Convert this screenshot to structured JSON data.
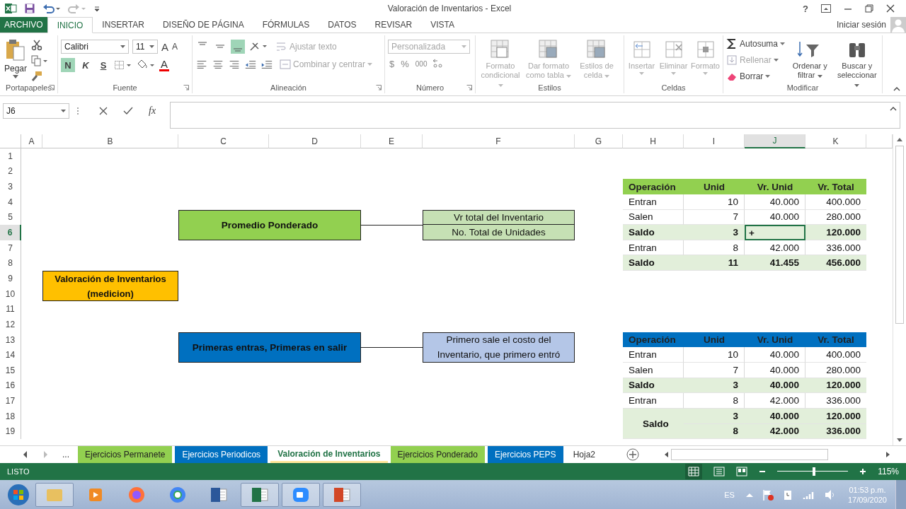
{
  "window": {
    "title": "Valoración de Inventarios - Excel",
    "help": "?"
  },
  "ribbon": {
    "tabs": [
      {
        "label": "ARCHIVO",
        "kind": "file",
        "selected": false
      },
      {
        "label": "INICIO",
        "kind": "tab",
        "selected": true
      },
      {
        "label": "INSERTAR",
        "kind": "tab",
        "selected": false
      },
      {
        "label": "DISEÑO DE PÁGINA",
        "kind": "tab",
        "selected": false
      },
      {
        "label": "FÓRMULAS",
        "kind": "tab",
        "selected": false
      },
      {
        "label": "DATOS",
        "kind": "tab",
        "selected": false
      },
      {
        "label": "REVISAR",
        "kind": "tab",
        "selected": false
      },
      {
        "label": "VISTA",
        "kind": "tab",
        "selected": false
      }
    ],
    "sign_in": "Iniciar sesión",
    "clipboard": {
      "label": "Portapapeles",
      "paste": "Pegar"
    },
    "font": {
      "label": "Fuente",
      "name": "Calibri",
      "size": "11",
      "grow": "A",
      "shrink": "A",
      "color_letter": "A",
      "styles": [
        {
          "label": "N",
          "selected": true
        },
        {
          "label": "K",
          "selected": false
        },
        {
          "label": "S",
          "selected": false
        }
      ]
    },
    "alignment": {
      "label": "Alineación",
      "vertical": [
        {
          "selected": false
        },
        {
          "selected": false
        },
        {
          "selected": true
        }
      ],
      "wrap": {
        "label": "Ajustar texto",
        "disabled": true
      },
      "merge": {
        "label": "Combinar y centrar",
        "disabled": true
      }
    },
    "number": {
      "label": "Número",
      "format": {
        "value": "Personalizada",
        "disabled": true
      },
      "symbols": [
        "$",
        "%",
        "000"
      ]
    },
    "styles": {
      "label": "Estilos",
      "buttons": [
        {
          "label": "Formato condicional",
          "disabled": true
        },
        {
          "label": "Dar formato como tabla",
          "disabled": true
        },
        {
          "label": "Estilos de celda",
          "disabled": true
        }
      ]
    },
    "cells": {
      "label": "Celdas",
      "buttons": [
        {
          "label": "Insertar",
          "disabled": true
        },
        {
          "label": "Eliminar",
          "disabled": true
        },
        {
          "label": "Formato",
          "disabled": true
        }
      ]
    },
    "editing": {
      "label": "Modificar",
      "small": [
        {
          "label": "Autosuma",
          "disabled": false
        },
        {
          "label": "Rellenar",
          "disabled": true
        },
        {
          "label": "Borrar",
          "disabled": false
        }
      ],
      "large": [
        {
          "label": "Ordenar y filtrar"
        },
        {
          "label": "Buscar y seleccionar"
        }
      ]
    }
  },
  "formula_bar": {
    "name_box": "J6",
    "fx": "fx"
  },
  "sheet": {
    "columns": [
      {
        "label": "A",
        "selected": false
      },
      {
        "label": "B",
        "selected": false
      },
      {
        "label": "C",
        "selected": false
      },
      {
        "label": "D",
        "selected": false
      },
      {
        "label": "E",
        "selected": false
      },
      {
        "label": "F",
        "selected": false
      },
      {
        "label": "G",
        "selected": false
      },
      {
        "label": "H",
        "selected": false
      },
      {
        "label": "I",
        "selected": false
      },
      {
        "label": "J",
        "selected": true
      },
      {
        "label": "K",
        "selected": false
      }
    ],
    "rows": [
      {
        "label": "1",
        "selected": false
      },
      {
        "label": "2",
        "selected": false
      },
      {
        "label": "3",
        "selected": false
      },
      {
        "label": "4",
        "selected": false
      },
      {
        "label": "5",
        "selected": false
      },
      {
        "label": "6",
        "selected": true
      },
      {
        "label": "7",
        "selected": false
      },
      {
        "label": "8",
        "selected": false
      },
      {
        "label": "9",
        "selected": false
      },
      {
        "label": "10",
        "selected": false
      },
      {
        "label": "11",
        "selected": false
      },
      {
        "label": "12",
        "selected": false
      },
      {
        "label": "13",
        "selected": false
      },
      {
        "label": "14",
        "selected": false
      },
      {
        "label": "15",
        "selected": false
      },
      {
        "label": "16",
        "selected": false
      },
      {
        "label": "17",
        "selected": false
      },
      {
        "label": "18",
        "selected": false
      },
      {
        "label": "19",
        "selected": false
      }
    ],
    "shapes": [
      {
        "text": "Promedio Ponderado",
        "color": "#92d050",
        "bold": true
      },
      {
        "text": "Vr total del Inventario",
        "color": "#c6e0b4",
        "bold": false
      },
      {
        "text": "No. Total de Unidades",
        "color": "#c6e0b4",
        "bold": false
      },
      {
        "text": "Valoración de Inventarios (medicion)",
        "color": "#ffc000",
        "bold": true
      },
      {
        "text": "Primeras entras, Primeras en salir",
        "color": "#0070c0",
        "bold": true
      },
      {
        "text": "Primero sale el costo del Inventario, que primero entró",
        "color": "#b4c6e7",
        "bold": false
      }
    ],
    "tables": [
      {
        "color": "#92d050",
        "headers": [
          "Operación",
          "Unid",
          "Vr. Unid",
          "Vr. Total"
        ],
        "rows": [
          {
            "label": "Entran",
            "bold": false,
            "lines": [
              [
                "10",
                "40.000",
                "400.000"
              ]
            ]
          },
          {
            "label": "Salen",
            "bold": false,
            "lines": [
              [
                "7",
                "40.000",
                "280.000"
              ]
            ]
          },
          {
            "label": "Saldo",
            "bold": true,
            "lines": [
              [
                "3",
                "+",
                "120.000"
              ]
            ]
          },
          {
            "label": "Entran",
            "bold": false,
            "lines": [
              [
                "8",
                "42.000",
                "336.000"
              ]
            ]
          },
          {
            "label": "Saldo",
            "bold": true,
            "lines": [
              [
                "11",
                "41.455",
                "456.000"
              ]
            ]
          }
        ]
      },
      {
        "color": "#0070c0",
        "headers": [
          "Operación",
          "Unid",
          "Vr. Unid",
          "Vr. Total"
        ],
        "rows": [
          {
            "label": "Entran",
            "bold": false,
            "lines": [
              [
                "10",
                "40.000",
                "400.000"
              ]
            ]
          },
          {
            "label": "Salen",
            "bold": false,
            "lines": [
              [
                "7",
                "40.000",
                "280.000"
              ]
            ]
          },
          {
            "label": "Saldo",
            "bold": true,
            "lines": [
              [
                "3",
                "40.000",
                "120.000"
              ]
            ]
          },
          {
            "label": "Entran",
            "bold": false,
            "lines": [
              [
                "8",
                "42.000",
                "336.000"
              ]
            ]
          },
          {
            "label": "Saldo",
            "bold": true,
            "lines": [
              [
                "3",
                "40.000",
                "120.000"
              ],
              [
                "8",
                "42.000",
                "336.000"
              ]
            ]
          }
        ]
      }
    ]
  },
  "sheet_tabs": {
    "more": "...",
    "tabs": [
      {
        "label": "Ejercicios Permanete",
        "color": "#92d050",
        "selected": false
      },
      {
        "label": "Ejercicios Periodicos",
        "color": "#0070c0",
        "selected": false
      },
      {
        "label": "Valoración de Inventarios",
        "color": "#ffe699",
        "selected": true
      },
      {
        "label": "Ejercicios Ponderado",
        "color": "#92d050",
        "selected": false
      },
      {
        "label": "Ejercicios PEPS",
        "color": "#0070c0",
        "selected": false
      },
      {
        "label": "Hoja2",
        "selected": false
      }
    ]
  },
  "status_bar": {
    "status": "LISTO",
    "zoom": {
      "level": 0.52,
      "reading": "115%"
    }
  },
  "taskbar": {
    "apps": [
      {
        "kind": "explorer",
        "running": true
      },
      {
        "kind": "media",
        "running": false
      },
      {
        "kind": "firefox",
        "running": false
      },
      {
        "kind": "chrome",
        "running": false
      },
      {
        "kind": "word",
        "running": false
      },
      {
        "kind": "excel",
        "running": true
      },
      {
        "kind": "zoom",
        "running": true
      },
      {
        "kind": "powerpoint",
        "running": true
      }
    ],
    "language": "ES",
    "time": "01:53 p.m.",
    "date": "17/09/2020"
  }
}
